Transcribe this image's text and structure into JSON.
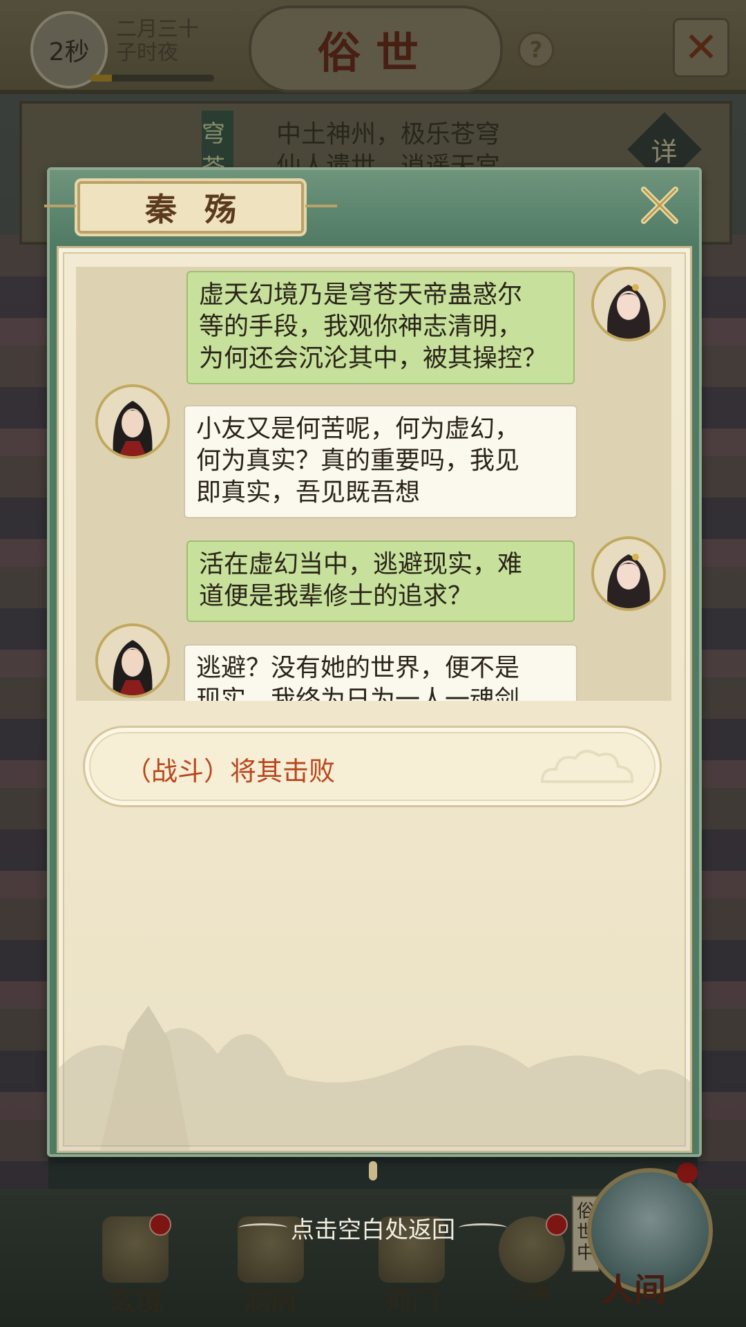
{
  "top_bar": {
    "timer": "2秒",
    "date_lines": [
      "二月三十",
      "子时夜"
    ],
    "title": "俗世",
    "help_icon": "?"
  },
  "info": {
    "banner": "穹苍",
    "lines": [
      "中土神州，极乐苍穹",
      "仙人遗世，逍遥天宫"
    ],
    "detail_label": "详"
  },
  "dialog": {
    "speaker": "秦殇",
    "messages": [
      {
        "side": "right",
        "style": "green",
        "lines": [
          "虚天幻境乃是穹苍天帝蛊惑尔",
          "等的手段，我观你神志清明，",
          "为何还会沉沦其中，被其操控？"
        ]
      },
      {
        "side": "left",
        "style": "white",
        "lines": [
          "小友又是何苦呢，何为虚幻，",
          "何为真实？真的重要吗，我见",
          "即真实，吾见既吾想"
        ]
      },
      {
        "side": "right",
        "style": "green",
        "lines": [
          "活在虚幻当中，逃避现实，难",
          "道便是我辈修士的追求？"
        ]
      },
      {
        "side": "left",
        "style": "white",
        "lines": [
          "逃避？没有她的世界，便不是",
          "现实，我终为日为一人一魂剑"
        ]
      }
    ],
    "choice": "（战斗）将其击败"
  },
  "bottom": {
    "hint": "点击空白处返回",
    "nav": [
      {
        "label": "玄境",
        "icon": "scroll-icon",
        "badge": true
      },
      {
        "label": "洞府",
        "icon": "pavilion-icon",
        "badge": false
      },
      {
        "label": "师门",
        "icon": "sect-gate-icon",
        "badge": false
      },
      {
        "label": "行囊",
        "icon": "pouch-icon",
        "badge": true
      }
    ],
    "status_tag": "俗世中",
    "world_button": "人间"
  },
  "colors": {
    "dialog_green": "#4f7a64",
    "bubble_green": "#c7e19d",
    "choice_text": "#b8461c",
    "badge_red": "#b8211b"
  }
}
